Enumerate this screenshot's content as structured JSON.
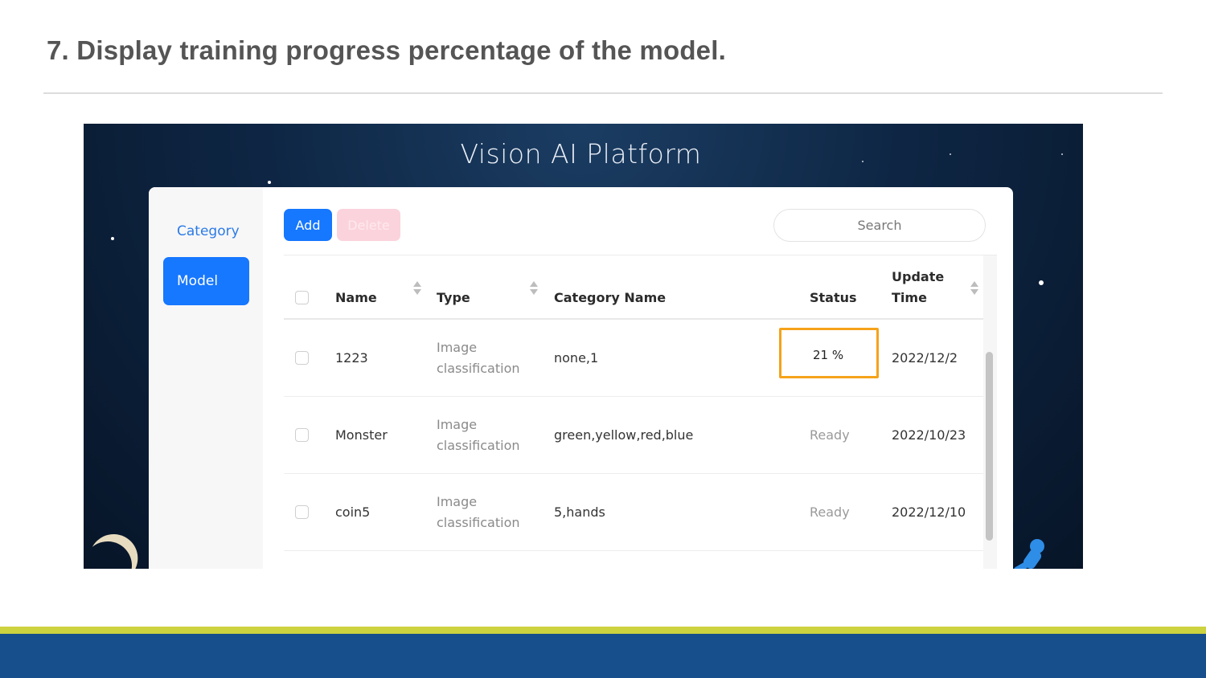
{
  "slide": {
    "title": "7. Display training progress percentage of the model."
  },
  "app": {
    "title": "Vision AI Platform"
  },
  "sidebar": {
    "items": [
      {
        "label": "Category",
        "active": false
      },
      {
        "label": "Model",
        "active": true
      }
    ]
  },
  "toolbar": {
    "add_label": "Add",
    "delete_label": "Delete",
    "search_placeholder": "Search"
  },
  "table": {
    "columns": {
      "name": "Name",
      "type": "Type",
      "category_name": "Category Name",
      "status": "Status",
      "update_time_line1": "Update",
      "update_time_line2": "Time"
    },
    "rows": [
      {
        "name": "1223",
        "type_line1": "Image",
        "type_line2": "classification",
        "category": "none,1",
        "status": "21 %",
        "update_time": "2022/12/2"
      },
      {
        "name": "Monster",
        "type_line1": "Image",
        "type_line2": "classification",
        "category": "green,yellow,red,blue",
        "status": "Ready",
        "update_time": "2022/10/23"
      },
      {
        "name": "coin5",
        "type_line1": "Image",
        "type_line2": "classification",
        "category": "5,hands",
        "status": "Ready",
        "update_time": "2022/12/10"
      }
    ]
  },
  "colors": {
    "primary": "#1677ff",
    "highlight": "#f5a31a",
    "footer_accent": "#cdd23f",
    "footer_bar": "#164f8b"
  },
  "icons": {
    "sort": "sort-arrows-icon",
    "moon": "moon-icon",
    "astronaut": "astronaut-icon"
  }
}
